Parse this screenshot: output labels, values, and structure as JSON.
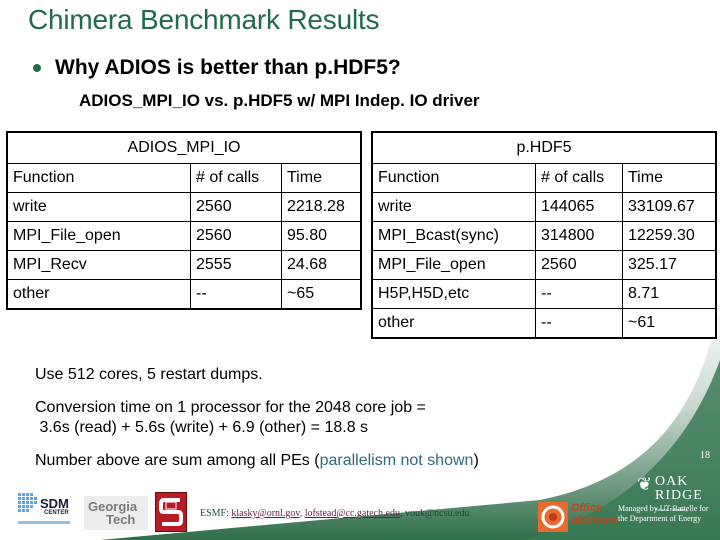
{
  "slide": {
    "title": "Chimera Benchmark Results",
    "bullet": "Why ADIOS is better than p.HDF5?",
    "sub_bullet": "ADIOS_MPI_IO vs. p.HDF5 w/ MPI Indep. IO driver"
  },
  "tables": {
    "adios": {
      "caption": "ADIOS_MPI_IO",
      "headers": [
        "Function",
        "# of calls",
        "Time"
      ],
      "rows": [
        [
          "write",
          "2560",
          "2218.28"
        ],
        [
          "MPI_File_open",
          "2560",
          "95.80"
        ],
        [
          "MPI_Recv",
          "2555",
          "24.68"
        ],
        [
          "other",
          "--",
          "~65"
        ]
      ]
    },
    "phdf5": {
      "caption": "p.HDF5",
      "headers": [
        "Function",
        "# of calls",
        "Time"
      ],
      "rows": [
        [
          "write",
          "144065",
          "33109.67"
        ],
        [
          "MPI_Bcast(sync)",
          "314800",
          "12259.30"
        ],
        [
          "MPI_File_open",
          "2560",
          "325.17"
        ],
        [
          "H5P,H5D,etc",
          "--",
          "8.71"
        ],
        [
          "other",
          "--",
          "~61"
        ]
      ]
    }
  },
  "notes": {
    "cores": "Use 512 cores, 5 restart dumps.",
    "conversion_line1": "Conversion time on 1 processor for the 2048 core job =",
    "conversion_line2": " 3.6s (read) + 5.6s (write) + 6.9 (other) = 18.8 s",
    "sum_prefix": "Number above are sum among all PEs (",
    "sum_accent": "parallelism not shown",
    "sum_suffix": ")"
  },
  "footer": {
    "page_number": "18",
    "contact_prefix": "ESMF: ",
    "contact_link1": "klasky@ornl.gov",
    "contact_sep1": ", ",
    "contact_link2": "lofstead@cc.gatech.edu",
    "contact_sep2": ", vouk@ncsu.edu",
    "logos": {
      "sdm_line1": "SDM",
      "sdm_line2": "CENTER",
      "gt_line1": "Georgia",
      "gt_line2": "Tech",
      "doe_line1": "Office of",
      "doe_line2": "Science",
      "oak_line1": "OAK",
      "oak_line2": "RIDGE",
      "oak_line3": "National Laboratory"
    },
    "managed_by": "Managed by UT-Battelle for the Department of Energy"
  },
  "colors": {
    "title": "#1f6b4a",
    "accent_text": "#2f6b7a",
    "footer_green": "#3d7a58",
    "link": "#6b1a4f"
  }
}
